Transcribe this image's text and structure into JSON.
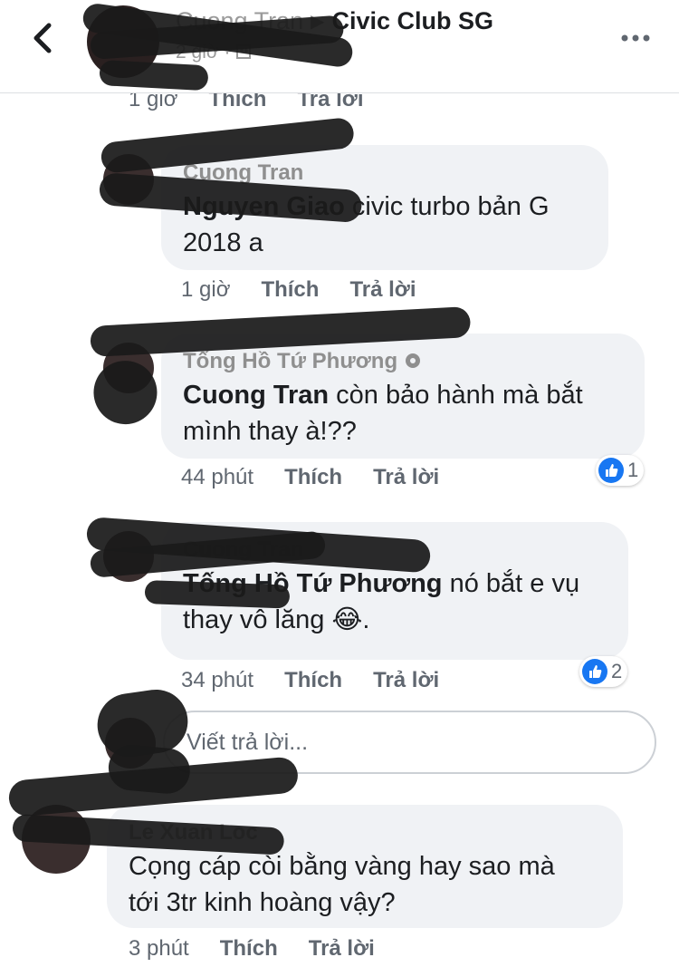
{
  "header": {
    "poster_name": "Cuong Tran",
    "separator": "▶",
    "group_name": "Civic Club SG",
    "time": "2 giờ · ",
    "privacy_icon": "group-privacy-icon",
    "back_icon": "back-chevron-icon",
    "more_icon": "more-options-icon"
  },
  "top_meta": {
    "time": "1 giờ",
    "like": "Thích",
    "reply": "Trả lời"
  },
  "comments": [
    {
      "author": "Cuong Tran",
      "tag": "Nguyen Giao",
      "text_line1": " civic turbo bản G",
      "text_line2": "2018 a",
      "time": "1 giờ",
      "like": "Thích",
      "reply": "Trả lời"
    },
    {
      "author": "Tống Hồ Tứ Phương",
      "tag": "Cuong Tran",
      "text_line1": " còn bảo hành mà bắt",
      "text_line2": "mình thay à!??",
      "time": "44 phút",
      "like": "Thích",
      "reply": "Trả lời",
      "reaction_count": "1"
    },
    {
      "author": "Cuong Tran",
      "tag": "Tống Hồ Tứ Phương",
      "text_line1": " nó bắt e vụ",
      "text_line2": "thay vô lăng ",
      "text_end": ".",
      "emoji": "😂",
      "time": "34 phút",
      "like": "Thích",
      "reply": "Trả lời",
      "reaction_count": "2"
    },
    {
      "author": "Le Xuan Loc",
      "text_line1": "Cọng cáp còi bằng vàng hay sao mà",
      "text_line2": "tới 3tr kinh hoàng vậy?",
      "time": "3 phút",
      "like": "Thích",
      "reply": "Trả lời"
    }
  ],
  "reply_input": {
    "placeholder": "Viết trả lời..."
  },
  "colors": {
    "like_blue": "#1877f2",
    "bubble_bg": "#f0f2f5",
    "meta_gray": "#606770"
  }
}
